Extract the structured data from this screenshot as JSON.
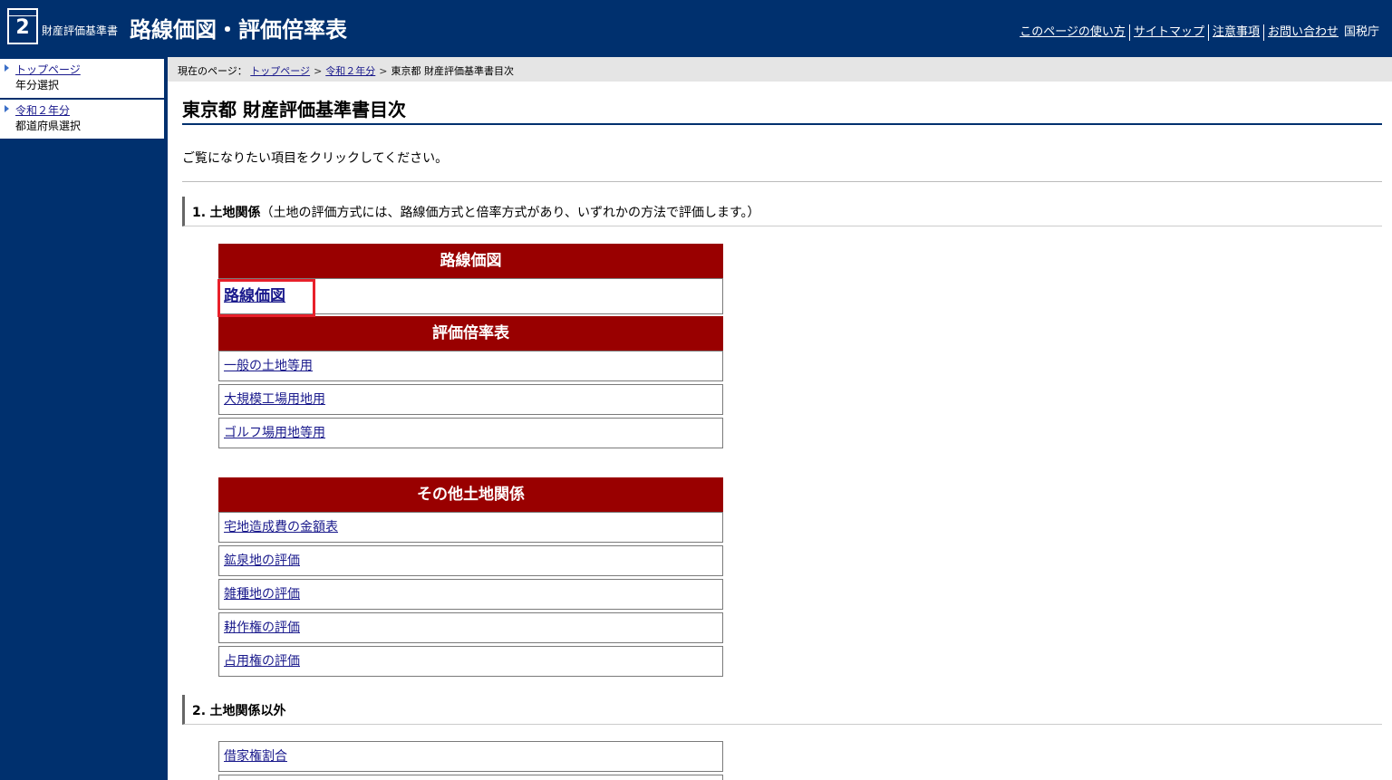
{
  "header": {
    "logo_number": "2",
    "site_sub": "財産評価基準書",
    "site_main": "路線価図・評価倍率表",
    "nav": [
      "このページの使い方",
      "サイトマップ",
      "注意事項",
      "お問い合わせ"
    ],
    "agency": "国税庁"
  },
  "sidebar": {
    "items": [
      {
        "link": "トップページ",
        "sub": "年分選択"
      },
      {
        "link": "令和２年分",
        "sub": "都道府県選択"
      }
    ]
  },
  "breadcrumb": {
    "prefix": "現在のページ：",
    "links": [
      "トップページ",
      "令和２年分"
    ],
    "current": "東京都 財産評価基準書目次"
  },
  "page": {
    "title": "東京都 財産評価基準書目次",
    "intro": "ご覧になりたい項目をクリックしてください。"
  },
  "section1": {
    "number": "1.",
    "title": "土地関係",
    "note": "（土地の評価方式には、路線価方式と倍率方式があり、いずれかの方法で評価します。）",
    "rosenka_head": "路線価図",
    "rosenka_link": "路線価図",
    "bairitsu_head": "評価倍率表",
    "bairitsu_links": [
      "一般の土地等用",
      "大規模工場用地用",
      "ゴルフ場用地等用"
    ],
    "other_head": "その他土地関係",
    "other_links": [
      "宅地造成費の金額表",
      "鉱泉地の評価",
      "雑種地の評価",
      "耕作権の評価",
      "占用権の評価"
    ]
  },
  "section2": {
    "number": "2.",
    "title": "土地関係以外",
    "links": [
      "借家権割合"
    ]
  }
}
